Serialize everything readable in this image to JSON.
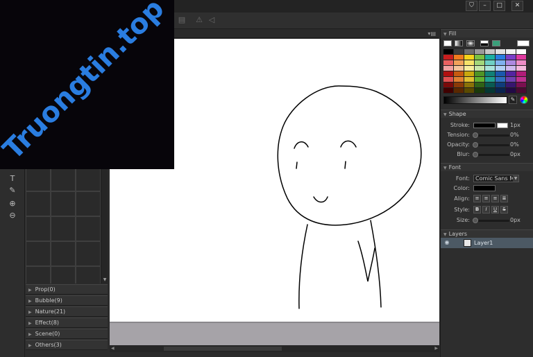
{
  "logo": {
    "text": "Truongtin.top"
  },
  "window": {
    "buttons": [
      {
        "name": "pin-button",
        "glyph": "⛉"
      },
      {
        "name": "minimize-button",
        "glyph": "–"
      },
      {
        "name": "maximize-button",
        "glyph": "□"
      },
      {
        "name": "close-button",
        "glyph": "✕"
      }
    ]
  },
  "toolbar": {
    "icons": [
      "layer-align-icon",
      "warning-icon",
      "flip-icon"
    ]
  },
  "tools": [
    {
      "name": "text-tool-icon",
      "glyph": "T"
    },
    {
      "name": "brush-tool-icon",
      "glyph": "✎"
    },
    {
      "name": "zoom-in-icon",
      "glyph": "⊕"
    },
    {
      "name": "zoom-out-icon",
      "glyph": "⊖"
    }
  ],
  "categories": [
    {
      "label": "Prop(0)"
    },
    {
      "label": "Bubble(9)"
    },
    {
      "label": "Nature(21)"
    },
    {
      "label": "Effect(8)"
    },
    {
      "label": "Scene(0)"
    },
    {
      "label": "Others(3)"
    }
  ],
  "panels": {
    "fill": {
      "title": "Fill",
      "swatches": [
        "#000000",
        "#3c3c3c",
        "#6e6e6e",
        "#9a9a9a",
        "#c8c8c8",
        "#e2e2e2",
        "#f2f2f2",
        "#ffffff",
        "#c81e1e",
        "#f07b1e",
        "#f5d31a",
        "#7ac142",
        "#1bb0a2",
        "#2a7de0",
        "#7a3fc8",
        "#e03aa0",
        "#ea6060",
        "#f2a25a",
        "#f7e36a",
        "#a3d77a",
        "#6fd0c4",
        "#7fb1ee",
        "#ad89e0",
        "#ee8cc6",
        "#f0a0a0",
        "#f5c49a",
        "#f9ee9e",
        "#c7e7ab",
        "#a8e3db",
        "#b0cff4",
        "#cdb8ee",
        "#f4b8dc",
        "#b01010",
        "#c75a10",
        "#c9a80e",
        "#4f9426",
        "#118076",
        "#1a58ac",
        "#5424a0",
        "#b01c78",
        "#e05050",
        "#e08030",
        "#e0c030",
        "#60b030",
        "#20a090",
        "#3070c0",
        "#7040b0",
        "#c03090",
        "#7a0a0a",
        "#8a3a08",
        "#8a7208",
        "#2f6216",
        "#0a5a52",
        "#103c7a",
        "#38166e",
        "#7a1050",
        "#400000",
        "#5a2800",
        "#5a4a00",
        "#1a3a0a",
        "#053834",
        "#0a2450",
        "#220a46",
        "#4a0a32"
      ]
    },
    "shape": {
      "title": "Shape",
      "stroke_label": "Stroke:",
      "stroke_value": "1px",
      "tension_label": "Tension:",
      "tension_value": "0%",
      "opacity_label": "Opacity:",
      "opacity_value": "0%",
      "blur_label": "Blur:",
      "blur_value": "0px"
    },
    "font": {
      "title": "Font",
      "font_label": "Font:",
      "font_value": "Comic Sans M",
      "color_label": "Color:",
      "align_label": "Align:",
      "style_label": "Style:",
      "style_buttons": [
        "B",
        "I",
        "U",
        "S"
      ],
      "size_label": "Size:",
      "size_value": "0px"
    },
    "layers": {
      "title": "Layers",
      "items": [
        {
          "name": "Layer1"
        }
      ]
    }
  }
}
